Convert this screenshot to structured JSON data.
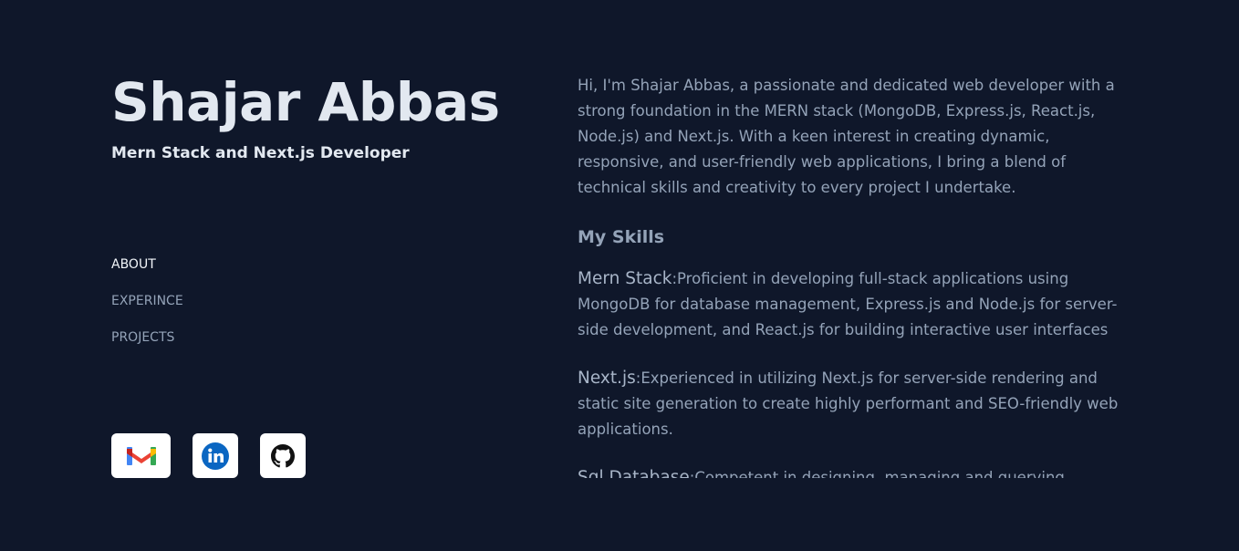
{
  "profile": {
    "name": "Shajar Abbas",
    "role": "Mern Stack and Next.js Developer"
  },
  "nav": {
    "items": [
      {
        "label": "ABOUT",
        "active": true
      },
      {
        "label": "EXPERINCE",
        "active": false
      },
      {
        "label": "PROJECTS",
        "active": false
      }
    ]
  },
  "socials": [
    {
      "icon": "gmail-icon"
    },
    {
      "icon": "linkedin-icon"
    },
    {
      "icon": "github-icon"
    }
  ],
  "about": {
    "intro": "Hi, I'm Shajar Abbas, a passionate and dedicated web developer with a strong foundation in the MERN stack (MongoDB, Express.js, React.js, Node.js) and Next.js. With a keen interest in creating dynamic, responsive, and user-friendly web applications, I bring a blend of technical skills and creativity to every project I undertake.",
    "skills_heading": "My Skills",
    "skills": [
      {
        "title": "Mern Stack",
        "desc": ":Proficient in developing full-stack applications using MongoDB for database management, Express.js and Node.js for server-side development, and React.js for building interactive user interfaces"
      },
      {
        "title": "Next.js",
        "desc": ":Experienced in utilizing Next.js for server-side rendering and static site generation to create highly performant and SEO-friendly web applications."
      },
      {
        "title": "Sql Database",
        "desc": ":Competent in designing, managing and querying"
      }
    ]
  },
  "colors": {
    "background": "#0f172a",
    "heading": "#e2e8f0",
    "muted": "#94a3b8"
  }
}
